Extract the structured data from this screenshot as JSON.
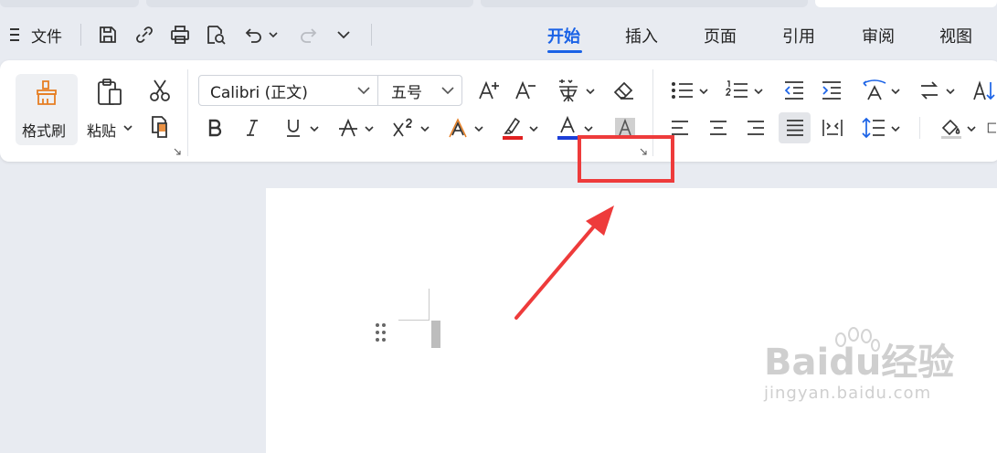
{
  "menubar": {
    "file_label": "文件",
    "tabs": [
      "开始",
      "插入",
      "页面",
      "引用",
      "审阅",
      "视图"
    ],
    "active_tab": "开始"
  },
  "clipboard": {
    "format_painter_label": "格式刷",
    "paste_label": "粘贴"
  },
  "font": {
    "family_value": "Calibri (正文)",
    "size_value": "五号"
  },
  "watermark": {
    "main": "Baidu经验",
    "sub": "jingyan.baidu.com"
  },
  "colors": {
    "accent": "#1a62e6",
    "highlight_red": "#ee3b3b",
    "font_color_blue": "#1c3fd8",
    "highlighter_red": "#e02020"
  }
}
